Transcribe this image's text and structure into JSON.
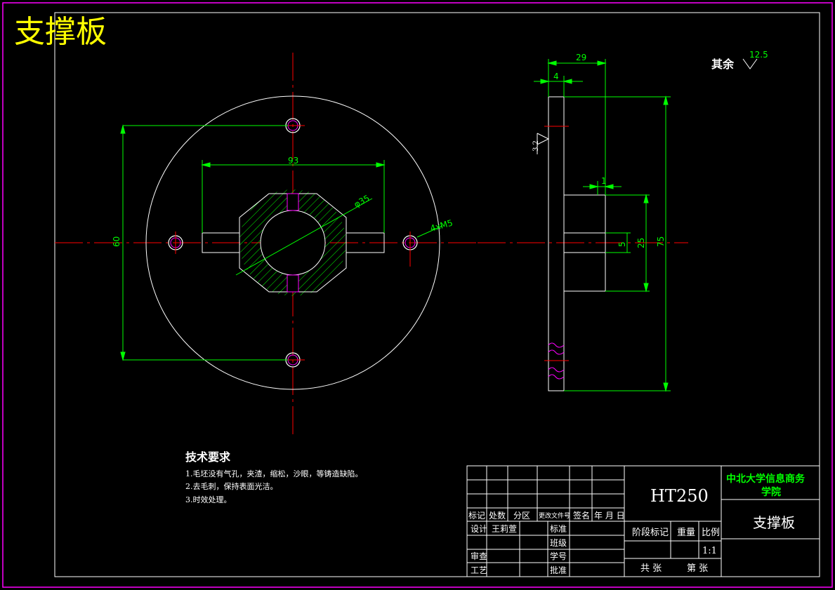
{
  "drawing": {
    "title": "支撑板",
    "colors": {
      "frame": "#ff00ff",
      "outline": "#ffffff",
      "center_line": "#ff0000",
      "dimension": "#00ff00",
      "title_text": "#ffff00",
      "hole": "#ff00ff"
    },
    "surface": {
      "other": "其余",
      "other_value": "12.5",
      "face_value": "3.2"
    },
    "dimensions": {
      "d29": "29",
      "d4": "4",
      "d93": "93",
      "d60": "60",
      "d35": "φ35",
      "holes": "4xM5",
      "d1": "1",
      "d5": "5",
      "d25": "25",
      "d75": "75"
    },
    "tech": {
      "heading": "技术要求",
      "lines": [
        "1.毛坯没有气孔，夹渣，缩松，沙眼，等铸造缺陷。",
        "2.去毛刺，保持表面光洁。",
        "3.时效处理。"
      ]
    },
    "title_block": {
      "material": "HT250",
      "school": "中北大学信息商务学院",
      "part_name": "支撑板",
      "labels": {
        "mark": "标记",
        "count": "处数",
        "zone": "分区",
        "doc_no": "更改文件号",
        "sign": "签名",
        "date": "年 月 日",
        "design": "设计",
        "designer": "王莉萱",
        "standard": "标准",
        "class": "班级",
        "check": "审查",
        "student_no": "学号",
        "process": "工艺",
        "approve": "批准",
        "stage": "阶段标记",
        "weight": "重量",
        "scale_label": "比例",
        "scale": "1:1",
        "total": "共  张",
        "sheet": "第  张"
      }
    }
  }
}
